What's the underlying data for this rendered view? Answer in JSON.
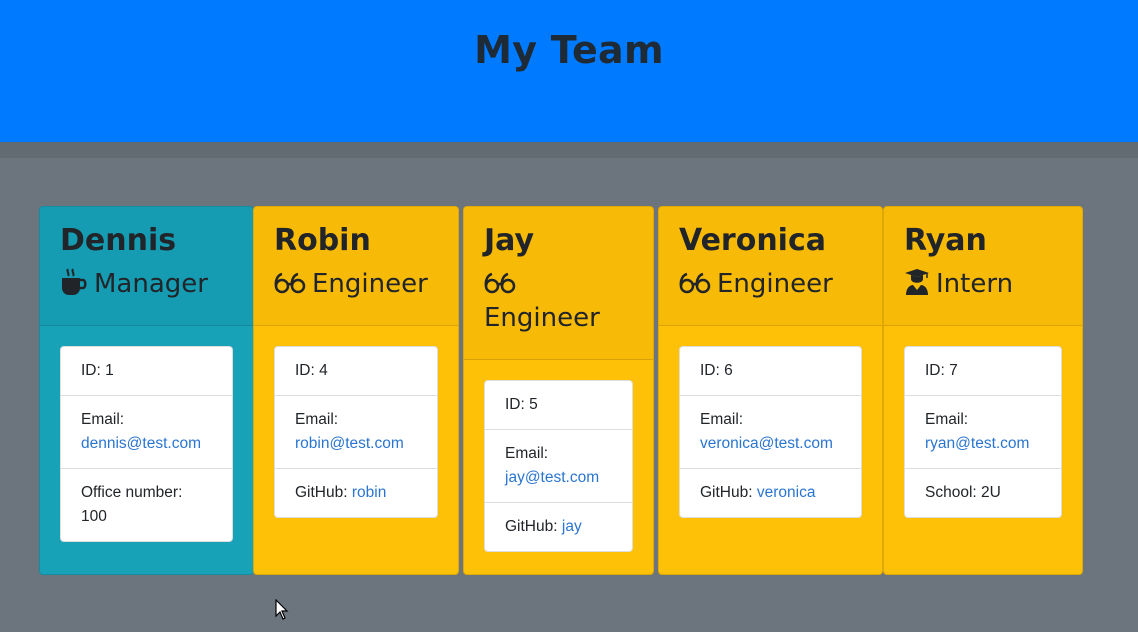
{
  "header": {
    "title": "My Team"
  },
  "colors": {
    "header": "#007bff",
    "manager": "#17a2b8",
    "member": "#ffc107",
    "link": "#2a75d0"
  },
  "team": [
    {
      "name": "Dennis",
      "role": "Manager",
      "icon": "coffee-icon",
      "id_label": "ID: 1",
      "email_label": "Email:",
      "email": "dennis@test.com",
      "extra_label": "Office number:",
      "extra_value": "100"
    },
    {
      "name": "Robin",
      "role": "Engineer",
      "icon": "glasses-icon",
      "id_label": "ID: 4",
      "email_label": "Email:",
      "email": "robin@test.com",
      "extra_label": "GitHub:",
      "extra_value": "robin"
    },
    {
      "name": "Jay",
      "role": "Engineer",
      "icon": "glasses-icon",
      "id_label": "ID: 5",
      "email_label": "Email:",
      "email": "jay@test.com",
      "extra_label": "GitHub:",
      "extra_value": "jay"
    },
    {
      "name": "Veronica",
      "role": "Engineer",
      "icon": "glasses-icon",
      "id_label": "ID: 6",
      "email_label": "Email:",
      "email": "veronica@test.com",
      "extra_label": "GitHub:",
      "extra_value": "veronica"
    },
    {
      "name": "Ryan",
      "role": "Intern",
      "icon": "graduate-icon",
      "id_label": "ID: 7",
      "email_label": "Email:",
      "email": "ryan@test.com",
      "extra_label": "School:",
      "extra_value": "2U"
    }
  ]
}
